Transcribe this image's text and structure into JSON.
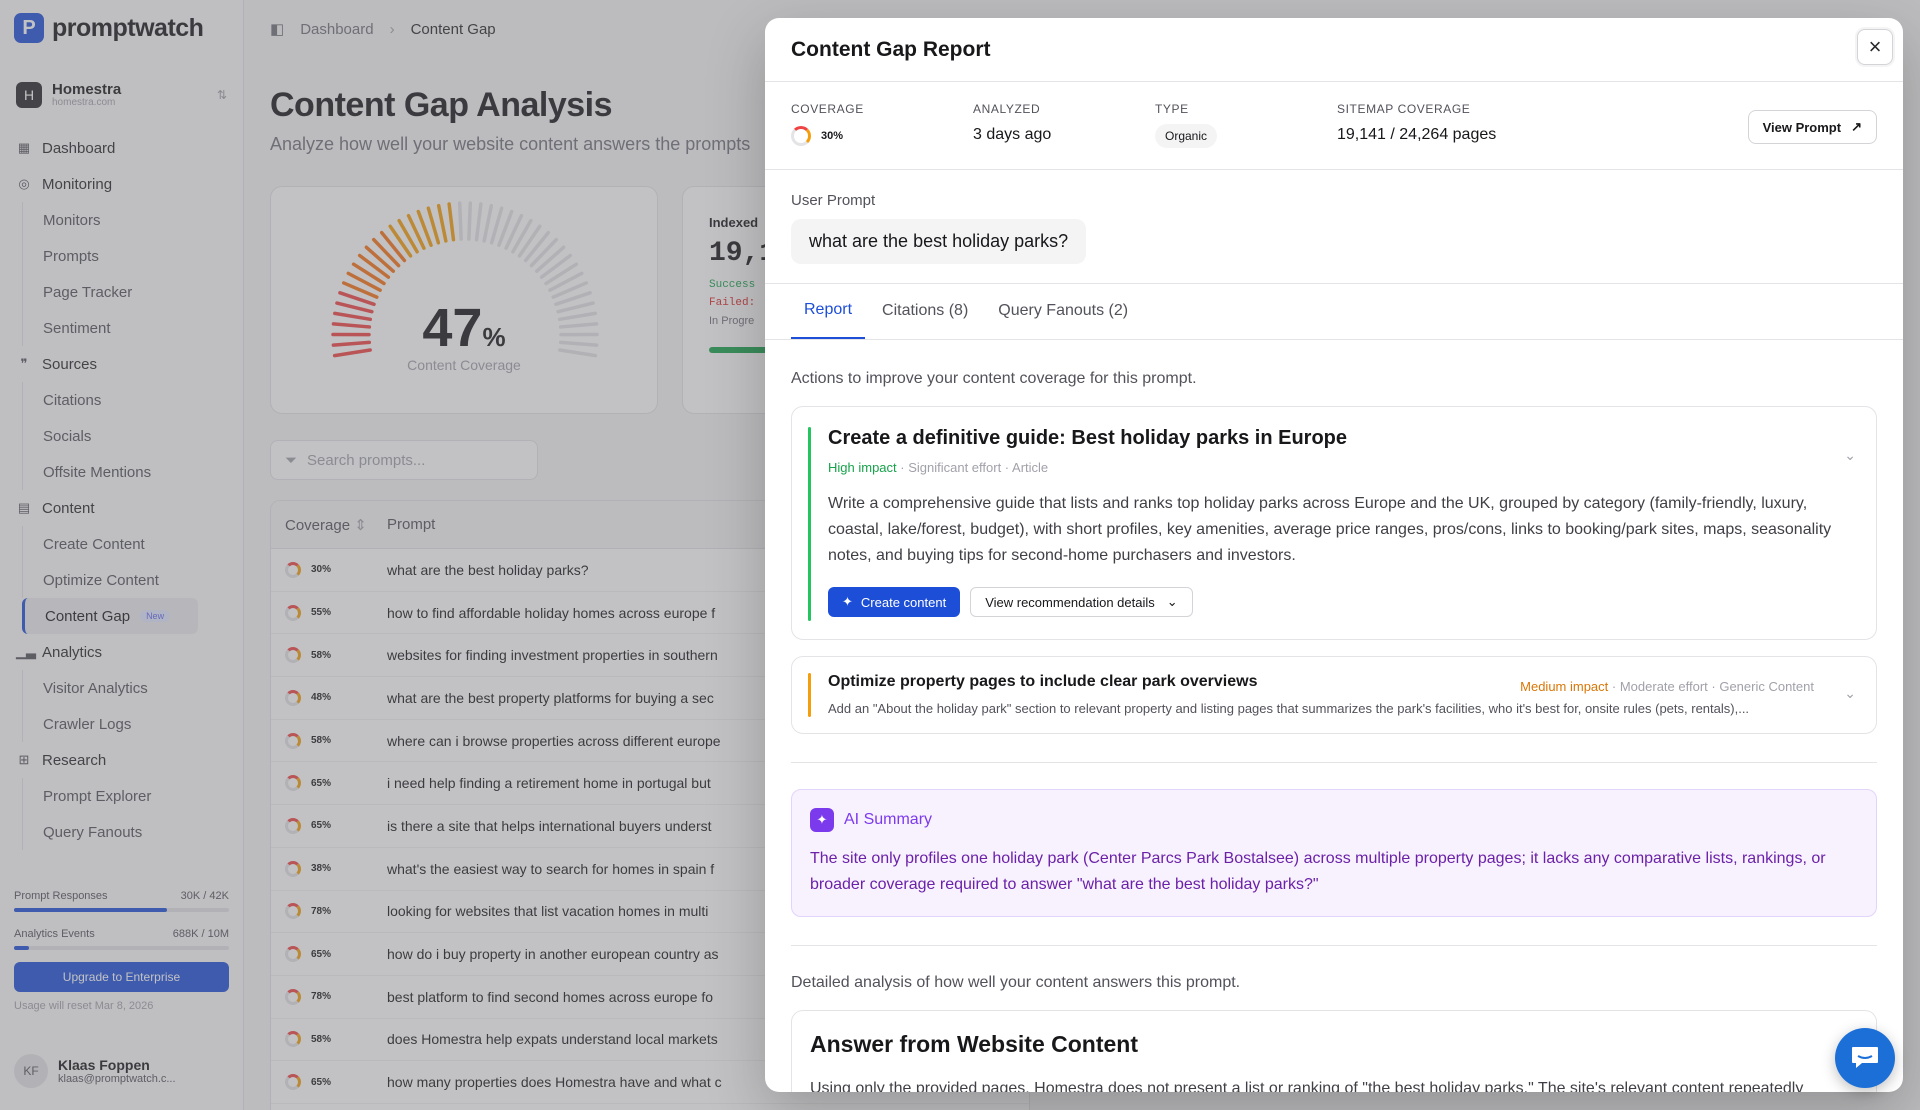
{
  "brand": {
    "name": "promptwatch",
    "mark": "P"
  },
  "workspace": {
    "name": "Homestra",
    "domain": "homestra.com",
    "icon": "H"
  },
  "nav": {
    "dashboard": "Dashboard",
    "monitoring": "Monitoring",
    "monitoring_items": [
      "Monitors",
      "Prompts",
      "Page Tracker",
      "Sentiment"
    ],
    "sources": "Sources",
    "sources_items": [
      "Citations",
      "Socials",
      "Offsite Mentions"
    ],
    "content": "Content",
    "content_items": [
      "Create Content",
      "Optimize Content",
      "Content Gap"
    ],
    "content_gap_badge": "New",
    "analytics": "Analytics",
    "analytics_items": [
      "Visitor Analytics",
      "Crawler Logs"
    ],
    "research": "Research",
    "research_items": [
      "Prompt Explorer",
      "Query Fanouts"
    ]
  },
  "usage": {
    "prompt_label": "Prompt Responses",
    "prompt_value": "30K / 42K",
    "prompt_fraction": 0.71,
    "events_label": "Analytics Events",
    "events_value": "688K / 10M",
    "events_fraction": 0.07,
    "upgrade": "Upgrade to Enterprise",
    "reset": "Usage will reset Mar 8, 2026"
  },
  "user": {
    "initials": "KF",
    "name": "Klaas Foppen",
    "email": "klaas@promptwatch.c..."
  },
  "breadcrumb": {
    "root": "Dashboard",
    "current": "Content Gap"
  },
  "page": {
    "title": "Content Gap Analysis",
    "subtitle": "Analyze how well your website content answers the prompts",
    "coverage_value": "47",
    "coverage_unit": "%",
    "coverage_label": "Content Coverage",
    "coverage_fraction": 0.47,
    "indexed_label": "Indexed",
    "indexed_value": "19,1",
    "success_label": "Success",
    "failed_label": "Failed:",
    "progress_label": "In Progre",
    "search_placeholder": "Search prompts...",
    "col_coverage": "Coverage",
    "col_prompt": "Prompt"
  },
  "rows": [
    {
      "cov": "30%",
      "prompt": "what are the best holiday parks?"
    },
    {
      "cov": "55%",
      "prompt": "how to find affordable holiday homes across europe f"
    },
    {
      "cov": "58%",
      "prompt": "websites for finding investment properties in southern"
    },
    {
      "cov": "48%",
      "prompt": "what are the best property platforms for buying a sec"
    },
    {
      "cov": "58%",
      "prompt": "where can i browse properties across different europe"
    },
    {
      "cov": "65%",
      "prompt": "i need help finding a retirement home in portugal but"
    },
    {
      "cov": "65%",
      "prompt": "is there a site that helps international buyers underst"
    },
    {
      "cov": "38%",
      "prompt": "what's the easiest way to search for homes in spain f"
    },
    {
      "cov": "78%",
      "prompt": "looking for websites that list vacation homes in multi"
    },
    {
      "cov": "65%",
      "prompt": "how do i buy property in another european country as"
    },
    {
      "cov": "78%",
      "prompt": "best platform to find second homes across europe fo"
    },
    {
      "cov": "58%",
      "prompt": "does Homestra help expats understand local markets"
    },
    {
      "cov": "65%",
      "prompt": "how many properties does Homestra have and what c"
    }
  ],
  "modal": {
    "title": "Content Gap Report",
    "meta": {
      "coverage_label": "COVERAGE",
      "coverage_value": "30%",
      "analyzed_label": "ANALYZED",
      "analyzed_value": "3 days ago",
      "type_label": "TYPE",
      "type_value": "Organic",
      "sitemap_label": "SITEMAP COVERAGE",
      "sitemap_value": "19,141 / 24,264 pages"
    },
    "view_prompt": "View Prompt",
    "user_prompt_label": "User Prompt",
    "user_prompt": "what are the best holiday parks?",
    "tabs": [
      "Report",
      "Citations (8)",
      "Query Fanouts (2)"
    ],
    "actions_intro": "Actions to improve your content coverage for this prompt.",
    "rec1": {
      "title": "Create a definitive guide: Best holiday parks in Europe",
      "impact": "High impact",
      "effort": "Significant effort",
      "type": "Article",
      "description": "Write a comprehensive guide that lists and ranks top holiday parks across Europe and the UK, grouped by category (family-friendly, luxury, coastal, lake/forest, budget), with short profiles, key amenities, average price ranges, pros/cons, links to booking/park sites, maps, seasonality notes, and buying tips for second-home purchasers and investors.",
      "create_btn": "Create content",
      "details_btn": "View recommendation details"
    },
    "rec2": {
      "title": "Optimize property pages to include clear park overviews",
      "impact": "Medium impact",
      "effort": "Moderate effort",
      "type": "Generic Content",
      "description": "Add an \"About the holiday park\" section to relevant property and listing pages that summarizes the park's facilities, who it's best for, onsite rules (pets, rentals),..."
    },
    "ai_summary_title": "AI Summary",
    "ai_summary": "The site only profiles one holiday park (Center Parcs Park Bostalsee) across multiple property pages; it lacks any comparative lists, rankings, or broader coverage required to answer \"what are the best holiday parks?\"",
    "analysis_intro": "Detailed analysis of how well your content answers this prompt.",
    "answer_title": "Answer from Website Content",
    "answer_text": "Using only the provided pages, Homestra does not present a list or ranking of \"the best holiday parks.\" The site's relevant content repeatedly"
  },
  "colors": {
    "accent": "#1d4ed8",
    "high": "#16a34a",
    "medium": "#d97706",
    "ai": "#7c3aed"
  }
}
